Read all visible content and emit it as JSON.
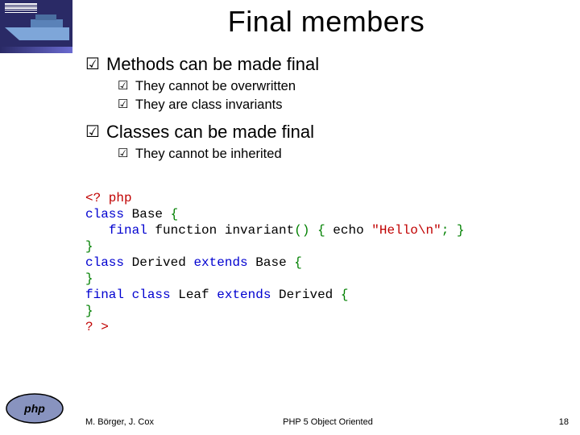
{
  "title": "Final members",
  "bullets": [
    {
      "text": "Methods can be made final",
      "subs": [
        "They cannot be overwritten",
        "They are class invariants"
      ]
    },
    {
      "text": "Classes can be made final",
      "subs": [
        "They cannot be inherited"
      ]
    }
  ],
  "code": {
    "open": "<? php",
    "l1_a": "class",
    "l1_b": " Base ",
    "l1_c": "{",
    "l2_a": "final",
    "l2_b": " function ",
    "l2_c": "invariant",
    "l2_d": "() { ",
    "l2_e": "echo ",
    "l2_f": "\"Hello\\n\"",
    "l2_g": "; }",
    "l3": "}",
    "l4_a": "class",
    "l4_b": " Derived ",
    "l4_c": "extends",
    "l4_d": " Base ",
    "l4_e": "{",
    "l5": "}",
    "l6_a": "final",
    "l6_b": " class",
    "l6_c": " Leaf ",
    "l6_d": "extends",
    "l6_e": " Derived ",
    "l6_f": "{",
    "l7": "}",
    "close": "? >"
  },
  "footer": {
    "left": "M. Börger, J. Cox",
    "center": "PHP 5 Object Oriented",
    "page": "18"
  },
  "glyphs": {
    "tick": "☑"
  }
}
